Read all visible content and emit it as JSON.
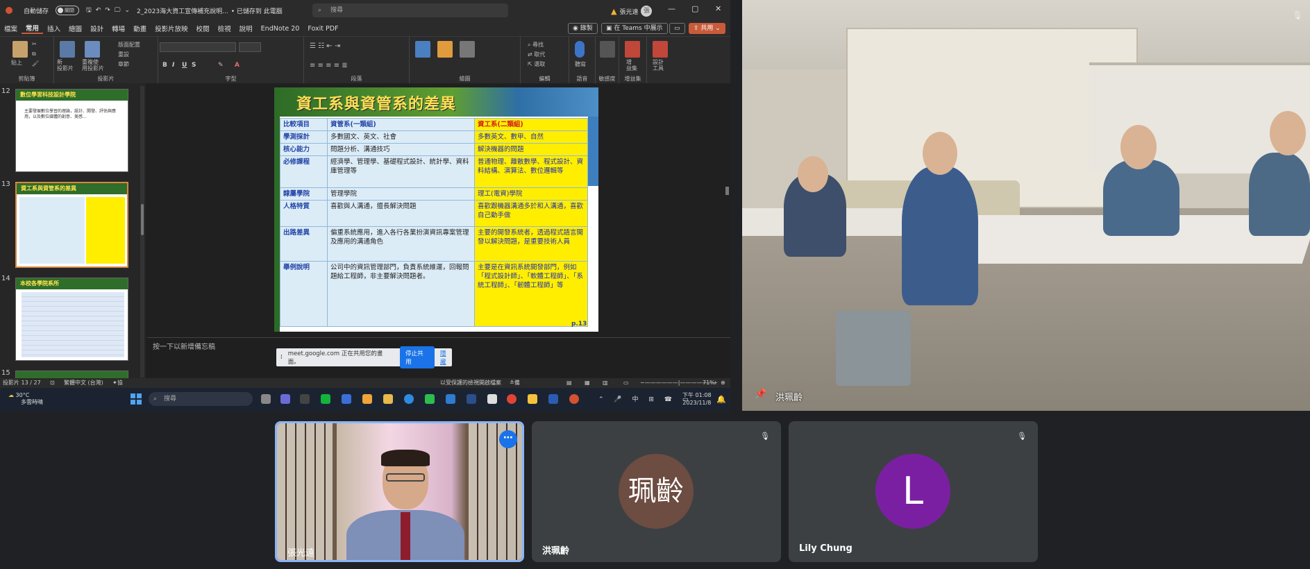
{
  "app": {
    "autosave_label": "自動儲存",
    "autosave_state": "關閉",
    "file_title": "2_2023海大資工宣傳補充說明...",
    "save_status": "• 已儲存到 此電腦",
    "search_placeholder": "搜尋",
    "user_name": "張光遠",
    "user_initial": "張"
  },
  "menu": {
    "items": [
      "檔案",
      "常用",
      "插入",
      "繪圖",
      "設計",
      "轉場",
      "動畫",
      "投影片放映",
      "校閱",
      "檢視",
      "說明",
      "EndNote 20",
      "Foxit PDF"
    ],
    "record": "錄製",
    "teams": "在 Teams 中展示",
    "share": "共用"
  },
  "ribbon": {
    "groups": [
      "剪貼簿",
      "投影片",
      "字型",
      "段落",
      "繪圖",
      "編輯",
      "語音",
      "敏感度",
      "增益集"
    ],
    "paste": "貼上",
    "new_slide": "新\n投影片",
    "reuse": "重複使\n用投影片",
    "layout": "版面配置",
    "reset": "重設",
    "section": "章節",
    "find": "尋找",
    "replace": "取代",
    "select": "選取",
    "dictate": "聽寫",
    "sensitivity": "敏感度",
    "addins": "增\n益集",
    "designer": "設計\n工具"
  },
  "thumbnails": [
    {
      "num": "12",
      "title": "數位學習科技設計學院",
      "text": "主要發展數位學習的理論，設計、開發、評估與應用，以及數位媒體的創意、美感…"
    },
    {
      "num": "13",
      "title": "資工系與資管系的差異",
      "text": ""
    },
    {
      "num": "14",
      "title": "本校各學院系所",
      "text": ""
    },
    {
      "num": "15",
      "title": "",
      "text": ""
    }
  ],
  "slide": {
    "title": "資工系與資管系的差異",
    "page": "p.13",
    "header": [
      "比較項目",
      "資管系(一類組)",
      "資工系(二類組)"
    ],
    "rows": [
      [
        "學測採計",
        "多數國文、英文、社會",
        "多數英文、數甲、自然"
      ],
      [
        "核心能力",
        "問題分析、溝通技巧",
        "解決機器的問題"
      ],
      [
        "必修課程",
        "經濟學、管理學、基礎程式設計、統計學、資料庫管理等",
        "普通物理、離散數學、程式設計、資料結構、演算法、數位邏輯等"
      ],
      [
        "隸屬學院",
        "管理學院",
        "理工(電資)學院"
      ],
      [
        "人格特質",
        "喜歡與人溝通，擅長解決問題",
        "喜歡跟機器溝通多於和人溝通，喜歡自己動手做"
      ],
      [
        "出路差異",
        "偏重系統應用，進入各行各業扮演資訊專案管理及應用的溝通角色",
        "主要的開發系統者，透過程式語言開發以解決問題，是重要技術人員"
      ],
      [
        "舉例說明",
        "公司中的資訊管理部門，負責系統維運，回報問題給工程師，非主要解決問題者。",
        "主要是在資訊系統開發部門，例如「程式設計師」、「軟體工程師」、「系統工程師」、「韌體工程師」等"
      ]
    ]
  },
  "notes_placeholder": "按一下以新增備忘稿",
  "share_bar": {
    "text": "meet.google.com 正在共用您的畫面。",
    "stop": "停止共用",
    "hide": "隱藏"
  },
  "status": {
    "slide_counter": "投影片 13 / 27",
    "language": "繁體中文 (台灣)",
    "accessibility": "協助工具: 調查",
    "protected": "以受保護的檢視開啟檔案",
    "notes": "備忘稿",
    "zoom": "71%"
  },
  "taskbar": {
    "temp": "30°C",
    "weather": "多雲時晴",
    "search": "搜尋",
    "ime": "中",
    "time": "下午 01:08",
    "date": "2023/11/8"
  },
  "meet": {
    "pinned_name": "洪珮齡",
    "tiles": [
      {
        "name": "張光遠",
        "type": "video"
      },
      {
        "name": "洪珮齡",
        "initials": "珮齡",
        "color": "#6d4c41"
      },
      {
        "name": "Lily Chung",
        "initials": "L",
        "color": "#7b1fa2"
      }
    ]
  }
}
